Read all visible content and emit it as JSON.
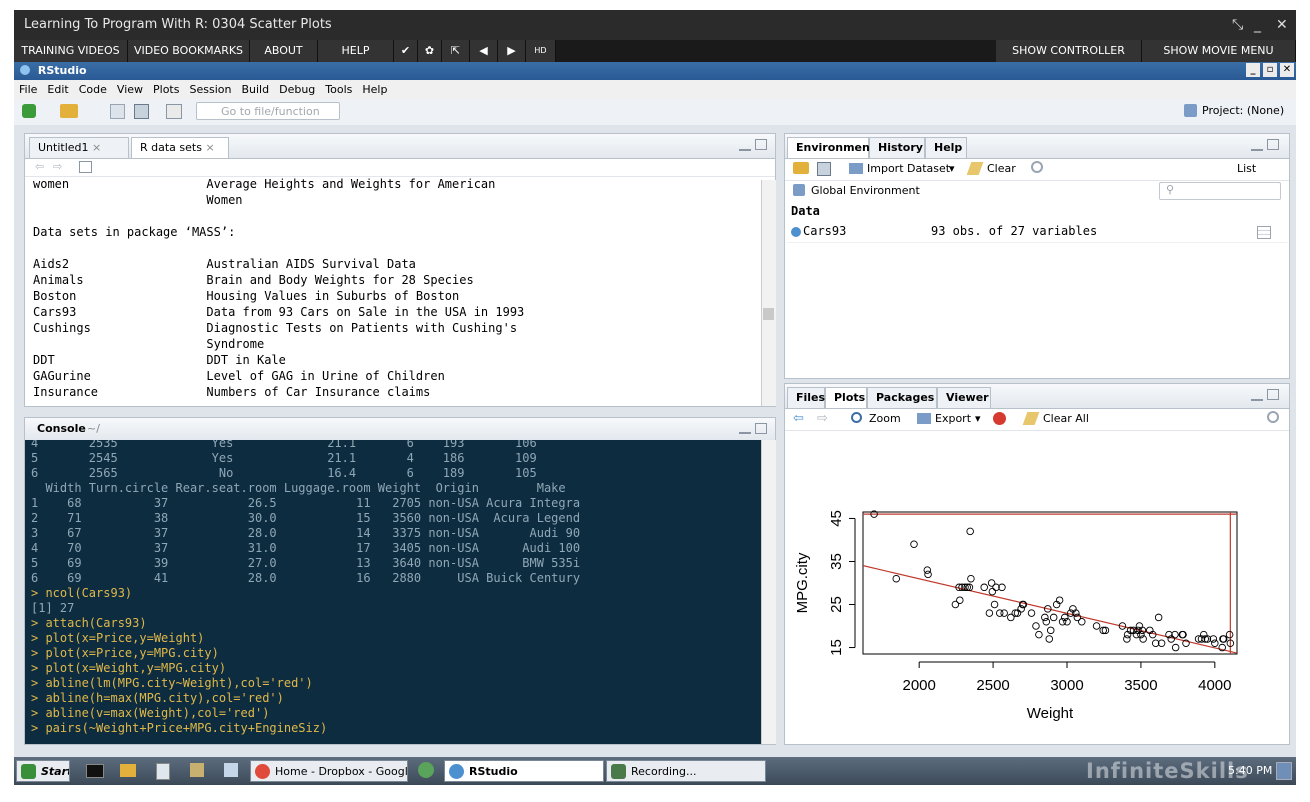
{
  "window": {
    "title": "Learning To Program With R: 0304 Scatter Plots",
    "controls": [
      "⤡",
      "_",
      "✕"
    ]
  },
  "player_nav": {
    "left": [
      "TRAINING VIDEOS",
      "VIDEO BOOKMARKS",
      "ABOUT",
      "HELP"
    ],
    "icons": [
      "✔",
      "✿",
      "⇱",
      "◀",
      "▶",
      "HD"
    ],
    "right": [
      "SHOW CONTROLLER",
      "SHOW MOVIE MENU"
    ]
  },
  "rstudio": {
    "title": "RStudio",
    "win_controls": [
      "_",
      "▫",
      "✕"
    ]
  },
  "menu": [
    "File",
    "Edit",
    "Code",
    "View",
    "Plots",
    "Session",
    "Build",
    "Debug",
    "Tools",
    "Help"
  ],
  "toolbar": {
    "goto_placeholder": "Go to file/function",
    "project": "Project: (None)"
  },
  "source": {
    "tabs": [
      "Untitled1",
      "R data sets"
    ],
    "lines": [
      "women                   Average Heights and Weights for American",
      "                        Women",
      "",
      "Data sets in package ‘MASS’:",
      "",
      "Aids2                   Australian AIDS Survival Data",
      "Animals                 Brain and Body Weights for 28 Species",
      "Boston                  Housing Values in Suburbs of Boston",
      "Cars93                  Data from 93 Cars on Sale in the USA in 1993",
      "Cushings                Diagnostic Tests on Patients with Cushing's",
      "                        Syndrome",
      "DDT                     DDT in Kale",
      "GAGurine                Level of GAG in Urine of Children",
      "Insurance               Numbers of Car Insurance claims"
    ]
  },
  "console": {
    "tab": "Console",
    "path": "~/",
    "lines": [
      {
        "t": "4       2535             Yes             21.1       6    193       106",
        "k": "out"
      },
      {
        "t": "5       2545             Yes             21.1       4    186       109",
        "k": "out"
      },
      {
        "t": "6       2565              No             16.4       6    189       105",
        "k": "out"
      },
      {
        "t": "  Width Turn.circle Rear.seat.room Luggage.room Weight  Origin        Make",
        "k": "out"
      },
      {
        "t": "1    68          37           26.5           11   2705 non-USA Acura Integra",
        "k": "out"
      },
      {
        "t": "2    71          38           30.0           15   3560 non-USA  Acura Legend",
        "k": "out"
      },
      {
        "t": "3    67          37           28.0           14   3375 non-USA       Audi 90",
        "k": "out"
      },
      {
        "t": "4    70          37           31.0           17   3405 non-USA      Audi 100",
        "k": "out"
      },
      {
        "t": "5    69          39           27.0           13   3640 non-USA      BMW 535i",
        "k": "out"
      },
      {
        "t": "6    69          41           28.0           16   2880     USA Buick Century",
        "k": "out"
      },
      {
        "t": "> ncol(Cars93)",
        "k": "cmd"
      },
      {
        "t": "[1] 27",
        "k": "out"
      },
      {
        "t": "> attach(Cars93)",
        "k": "cmd"
      },
      {
        "t": "> plot(x=Price,y=Weight)",
        "k": "cmd"
      },
      {
        "t": "> plot(x=Price,y=MPG.city)",
        "k": "cmd"
      },
      {
        "t": "> plot(x=Weight,y=MPG.city)",
        "k": "cmd"
      },
      {
        "t": "> abline(lm(MPG.city~Weight),col='red')",
        "k": "cmd"
      },
      {
        "t": "> abline(h=max(MPG.city),col='red')",
        "k": "cmd"
      },
      {
        "t": "> abline(v=max(Weight),col='red')",
        "k": "cmd"
      },
      {
        "t": "> pairs(~Weight+Price+MPG.city+EngineSiz)",
        "k": "cmd"
      }
    ]
  },
  "environment": {
    "tabs": [
      "Environment",
      "History",
      "Help"
    ],
    "import": "Import Dataset",
    "clear": "Clear",
    "list": "List",
    "scope": "Global Environment",
    "section": "Data",
    "items": [
      {
        "name": "Cars93",
        "value": "93 obs. of 27 variables"
      }
    ]
  },
  "plots": {
    "tabs": [
      "Files",
      "Plots",
      "Packages",
      "Viewer"
    ],
    "zoom": "Zoom",
    "export": "Export",
    "clear_all": "Clear All"
  },
  "chart_data": {
    "type": "scatter",
    "xlabel": "Weight",
    "ylabel": "MPG.city",
    "xticks": [
      2000,
      2500,
      3000,
      3500,
      4000
    ],
    "yticks": [
      15,
      25,
      35,
      45
    ],
    "xlim": [
      1620,
      4150
    ],
    "ylim": [
      13.5,
      46.5
    ],
    "line_color": "#c0392b",
    "regression": {
      "intercept": 47.05,
      "slope": -0.008033
    },
    "hline_y": 46,
    "vline_x": 4105,
    "points": [
      [
        1695,
        46
      ],
      [
        1845,
        31
      ],
      [
        1965,
        39
      ],
      [
        2055,
        33
      ],
      [
        2060,
        32
      ],
      [
        2245,
        25
      ],
      [
        2270,
        29
      ],
      [
        2275,
        26
      ],
      [
        2290,
        29
      ],
      [
        2310,
        29
      ],
      [
        2325,
        29
      ],
      [
        2345,
        42
      ],
      [
        2340,
        29
      ],
      [
        2350,
        31
      ],
      [
        2440,
        29
      ],
      [
        2475,
        23
      ],
      [
        2490,
        30
      ],
      [
        2495,
        28
      ],
      [
        2510,
        25
      ],
      [
        2520,
        29
      ],
      [
        2545,
        23
      ],
      [
        2560,
        29
      ],
      [
        2575,
        23
      ],
      [
        2620,
        22
      ],
      [
        2650,
        23
      ],
      [
        2665,
        23
      ],
      [
        2690,
        24
      ],
      [
        2700,
        25
      ],
      [
        2705,
        25
      ],
      [
        2760,
        23
      ],
      [
        2790,
        20
      ],
      [
        2810,
        18
      ],
      [
        2850,
        22
      ],
      [
        2860,
        21
      ],
      [
        2870,
        24
      ],
      [
        2880,
        17
      ],
      [
        2890,
        19
      ],
      [
        2910,
        22
      ],
      [
        2930,
        25
      ],
      [
        2950,
        26
      ],
      [
        2970,
        21
      ],
      [
        2985,
        22
      ],
      [
        3000,
        21
      ],
      [
        3025,
        23
      ],
      [
        3040,
        24
      ],
      [
        3060,
        23
      ],
      [
        3070,
        22
      ],
      [
        3100,
        21
      ],
      [
        3200,
        20
      ],
      [
        3245,
        19
      ],
      [
        3260,
        19
      ],
      [
        3375,
        20
      ],
      [
        3405,
        17
      ],
      [
        3410,
        18
      ],
      [
        3430,
        19
      ],
      [
        3450,
        19
      ],
      [
        3470,
        18
      ],
      [
        3480,
        19
      ],
      [
        3490,
        20
      ],
      [
        3500,
        18
      ],
      [
        3510,
        19
      ],
      [
        3515,
        17
      ],
      [
        3560,
        19
      ],
      [
        3580,
        18
      ],
      [
        3600,
        16
      ],
      [
        3620,
        22
      ],
      [
        3640,
        16
      ],
      [
        3690,
        18
      ],
      [
        3705,
        17
      ],
      [
        3730,
        18
      ],
      [
        3735,
        15
      ],
      [
        3780,
        18
      ],
      [
        3785,
        18
      ],
      [
        3805,
        16
      ],
      [
        3890,
        17
      ],
      [
        3910,
        17
      ],
      [
        3925,
        18
      ],
      [
        3935,
        17
      ],
      [
        3950,
        17
      ],
      [
        3990,
        17
      ],
      [
        4000,
        16
      ],
      [
        4050,
        15
      ],
      [
        4055,
        17
      ],
      [
        4060,
        17
      ],
      [
        4100,
        18
      ],
      [
        4105,
        16
      ]
    ]
  },
  "taskbar": {
    "start": "Start",
    "items": [
      "Home - Dropbox - Googl...",
      "RStudio",
      "Recording..."
    ],
    "time": "5:40 PM",
    "watermark": "InfiniteSkills"
  }
}
